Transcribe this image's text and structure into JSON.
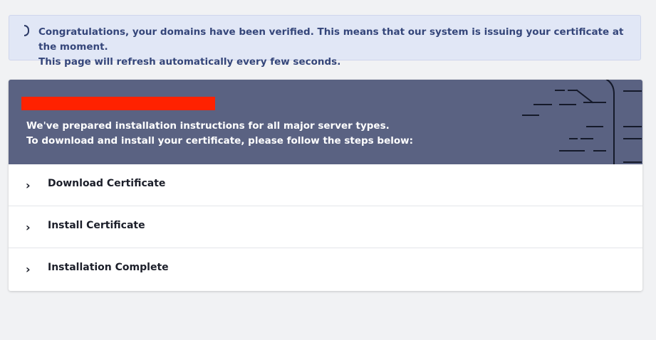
{
  "notice": {
    "icon": "spinner-icon",
    "text": "Congratulations, your domains have been verified. This means that our system is issuing your certificate at the moment.\nThis page will refresh automatically every few seconds.",
    "colors": {
      "background": "#e1e7f6",
      "text": "#35467a"
    }
  },
  "banner": {
    "instructions": "We've prepared installation instructions for all major server types.\nTo download and install your certificate, please follow the steps below:",
    "colors": {
      "background": "#5a6282",
      "text": "#ffffff",
      "redaction": "#ff2200"
    }
  },
  "steps": [
    {
      "label": "Download Certificate",
      "icon": "chevron-right-icon"
    },
    {
      "label": "Install Certificate",
      "icon": "chevron-right-icon"
    },
    {
      "label": "Installation Complete",
      "icon": "chevron-right-icon"
    }
  ]
}
